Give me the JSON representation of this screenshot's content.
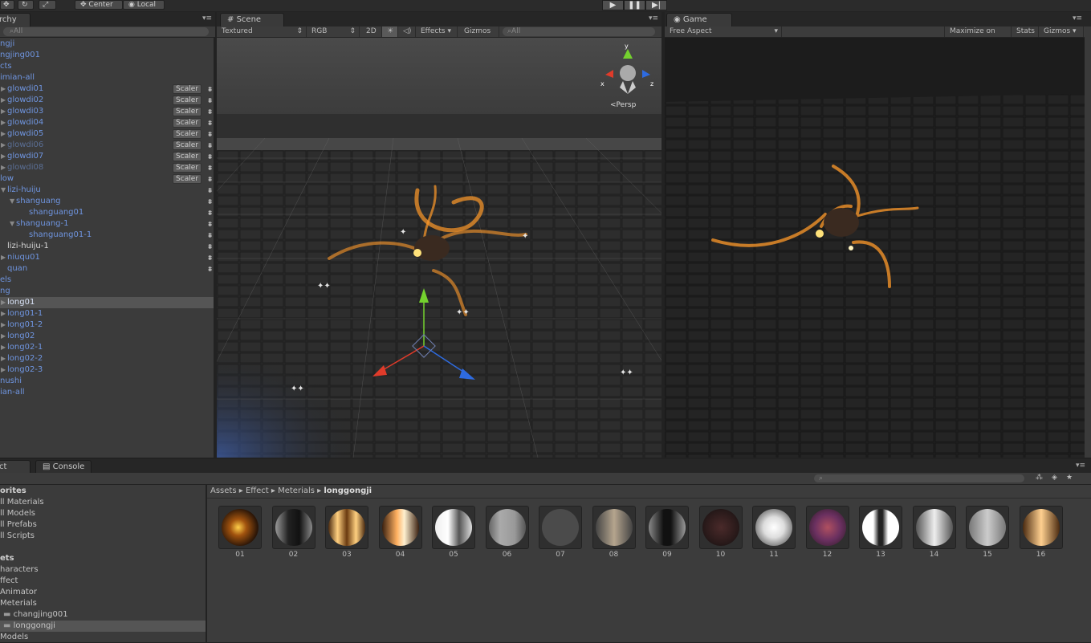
{
  "toolbar": {
    "pivot_label": "Center",
    "space_label": "Local",
    "play_icon": "play-icon",
    "pause_icon": "pause-icon",
    "step_icon": "step-icon"
  },
  "hierarchy": {
    "tab": "rchy",
    "search_placeholder": "All",
    "rows": [
      {
        "label": "ngji",
        "indent": 0,
        "arrow": "",
        "color": "blue",
        "scaler": false,
        "fx": false
      },
      {
        "label": "ngjing001",
        "indent": 0,
        "arrow": "",
        "color": "blue",
        "scaler": false,
        "fx": false
      },
      {
        "label": "cts",
        "indent": 0,
        "arrow": "",
        "color": "blue",
        "scaler": false,
        "fx": false
      },
      {
        "label": "imian-all",
        "indent": 0,
        "arrow": "",
        "color": "blue",
        "scaler": false,
        "fx": false
      },
      {
        "label": "glowdi01",
        "indent": 1,
        "arrow": "▶",
        "color": "blue",
        "scaler": true,
        "fx": true
      },
      {
        "label": "glowdi02",
        "indent": 1,
        "arrow": "▶",
        "color": "blue",
        "scaler": true,
        "fx": true
      },
      {
        "label": "glowdi03",
        "indent": 1,
        "arrow": "▶",
        "color": "blue",
        "scaler": true,
        "fx": true
      },
      {
        "label": "glowdi04",
        "indent": 1,
        "arrow": "▶",
        "color": "blue",
        "scaler": true,
        "fx": true
      },
      {
        "label": "glowdi05",
        "indent": 1,
        "arrow": "▶",
        "color": "blue",
        "scaler": true,
        "fx": true
      },
      {
        "label": "glowdi06",
        "indent": 1,
        "arrow": "▶",
        "color": "dim",
        "scaler": true,
        "fx": true
      },
      {
        "label": "glowdi07",
        "indent": 1,
        "arrow": "▶",
        "color": "blue",
        "scaler": true,
        "fx": true
      },
      {
        "label": "glowdi08",
        "indent": 1,
        "arrow": "▶",
        "color": "dim",
        "scaler": true,
        "fx": true
      },
      {
        "label": "low",
        "indent": 0,
        "arrow": "",
        "color": "blue",
        "scaler": true,
        "fx": true
      },
      {
        "label": "lizi-huiju",
        "indent": 1,
        "arrow": "▼",
        "color": "blue",
        "scaler": false,
        "fx": true
      },
      {
        "label": "shanguang",
        "indent": 2,
        "arrow": "▼",
        "color": "blue",
        "scaler": false,
        "fx": true
      },
      {
        "label": "shanguang01",
        "indent": 4,
        "arrow": "",
        "color": "blue",
        "scaler": false,
        "fx": true
      },
      {
        "label": "shanguang-1",
        "indent": 2,
        "arrow": "▼",
        "color": "blue",
        "scaler": false,
        "fx": true
      },
      {
        "label": "shanguang01-1",
        "indent": 4,
        "arrow": "",
        "color": "blue",
        "scaler": false,
        "fx": true
      },
      {
        "label": "lizi-huiju-1",
        "indent": 1,
        "arrow": "",
        "color": "white",
        "scaler": false,
        "fx": true
      },
      {
        "label": "niuqu01",
        "indent": 1,
        "arrow": "▶",
        "color": "blue",
        "scaler": false,
        "fx": true
      },
      {
        "label": "quan",
        "indent": 1,
        "arrow": "",
        "color": "blue",
        "scaler": false,
        "fx": true
      },
      {
        "label": "els",
        "indent": 0,
        "arrow": "",
        "color": "blue",
        "scaler": false,
        "fx": false
      },
      {
        "label": "ng",
        "indent": 0,
        "arrow": "",
        "color": "blue",
        "scaler": false,
        "fx": false
      },
      {
        "label": "long01",
        "indent": 1,
        "arrow": "▶",
        "color": "sel",
        "scaler": false,
        "fx": false
      },
      {
        "label": "long01-1",
        "indent": 1,
        "arrow": "▶",
        "color": "blue",
        "scaler": false,
        "fx": false
      },
      {
        "label": "long01-2",
        "indent": 1,
        "arrow": "▶",
        "color": "blue",
        "scaler": false,
        "fx": false
      },
      {
        "label": "long02",
        "indent": 1,
        "arrow": "▶",
        "color": "blue",
        "scaler": false,
        "fx": false
      },
      {
        "label": "long02-1",
        "indent": 1,
        "arrow": "▶",
        "color": "blue",
        "scaler": false,
        "fx": false
      },
      {
        "label": "long02-2",
        "indent": 1,
        "arrow": "▶",
        "color": "blue",
        "scaler": false,
        "fx": false
      },
      {
        "label": "long02-3",
        "indent": 1,
        "arrow": "▶",
        "color": "blue",
        "scaler": false,
        "fx": false
      },
      {
        "label": "nushi",
        "indent": 0,
        "arrow": "",
        "color": "blue",
        "scaler": false,
        "fx": false
      },
      {
        "label": "ian-all",
        "indent": 0,
        "arrow": "",
        "color": "blue",
        "scaler": false,
        "fx": false
      }
    ],
    "scaler_label": "Scaler"
  },
  "scene": {
    "tab": "Scene",
    "shading": "Textured",
    "render_mode": "RGB",
    "mode_2d": "2D",
    "effects": "Effects",
    "gizmos": "Gizmos",
    "search_placeholder": "All",
    "persp": "Persp",
    "axis_x": "x",
    "axis_y": "y",
    "axis_z": "z"
  },
  "game": {
    "tab": "Game",
    "aspect": "Free Aspect",
    "maximize": "Maximize on Play",
    "stats": "Stats",
    "gizmos": "Gizmos"
  },
  "project": {
    "tab": "ct",
    "console_tab": "Console",
    "breadcrumb": [
      "Assets",
      "Effect",
      "Meterials",
      "longgongji"
    ],
    "tree": [
      {
        "label": "orites",
        "style": "bold"
      },
      {
        "label": "ll Materials",
        "style": ""
      },
      {
        "label": "ll Models",
        "style": ""
      },
      {
        "label": "ll Prefabs",
        "style": ""
      },
      {
        "label": "ll Scripts",
        "style": ""
      },
      {
        "label": "",
        "style": ""
      },
      {
        "label": "ets",
        "style": "bold"
      },
      {
        "label": "haracters",
        "style": ""
      },
      {
        "label": "ffect",
        "style": ""
      },
      {
        "label": "Animator",
        "style": ""
      },
      {
        "label": "Meterials",
        "style": ""
      },
      {
        "label": "changjing001",
        "style": "folder"
      },
      {
        "label": "longgongji",
        "style": "folder-sel"
      },
      {
        "label": "Models",
        "style": ""
      }
    ],
    "assets": [
      "01",
      "02",
      "03",
      "04",
      "05",
      "06",
      "07",
      "08",
      "09",
      "10",
      "11",
      "12",
      "13",
      "14",
      "15",
      "16"
    ]
  },
  "colors": {
    "hier_blue": "#6f95e0",
    "selection": "#555555",
    "fire": "#ff9a2a",
    "gizmo_x": "#e03b2a",
    "gizmo_y": "#74d12e",
    "gizmo_z": "#2e6be0"
  }
}
